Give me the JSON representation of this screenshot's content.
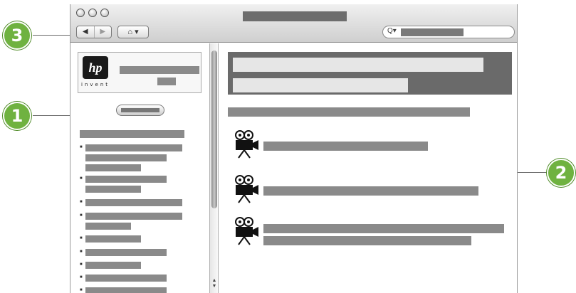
{
  "callouts": [
    {
      "label": "3"
    },
    {
      "label": "1"
    },
    {
      "label": "2"
    }
  ],
  "toolbar": {
    "back_arrow": "◀",
    "forward_arrow": "▶",
    "home_icon_glyph": "⌂ ▾",
    "search_glyph": "Q▾"
  },
  "logo": {
    "brand": "hp",
    "tagline": "invent"
  },
  "scrollbar": {
    "arrows": "▲\n▼"
  },
  "colors": {
    "callout_green": "#6fb240",
    "banner_dark": "#6a6a6a",
    "placeholder_gray": "#8a8a8a"
  },
  "icons": {
    "video": "movie-camera-icon"
  }
}
